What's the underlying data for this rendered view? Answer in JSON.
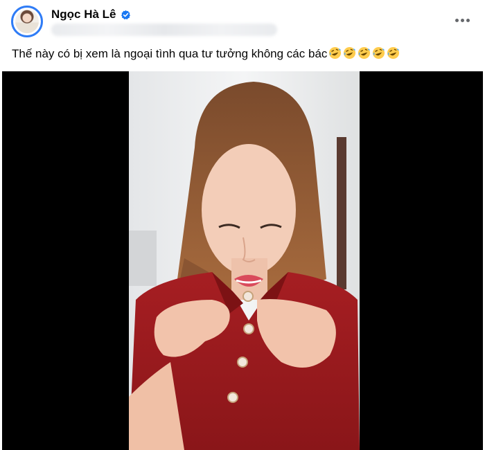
{
  "post": {
    "author": "Ngọc Hà Lê",
    "caption": "Thế này có bị xem là ngoại tình qua tư tưởng không các bác",
    "caption_emojis": [
      "rolling-on-floor-laughing",
      "rolling-on-floor-laughing",
      "rolling-on-floor-laughing",
      "rolling-on-floor-laughing",
      "rolling-on-floor-laughing"
    ]
  },
  "icons": {
    "verified": "verified-badge-icon",
    "more": "more-options-icon"
  },
  "colors": {
    "verified_blue": "#1877f2",
    "avatar_ring": "#2f7cf6",
    "text_primary": "#050505",
    "text_secondary": "#65676b",
    "video_background": "#000000",
    "shirt_red": "#9e1b1e"
  }
}
